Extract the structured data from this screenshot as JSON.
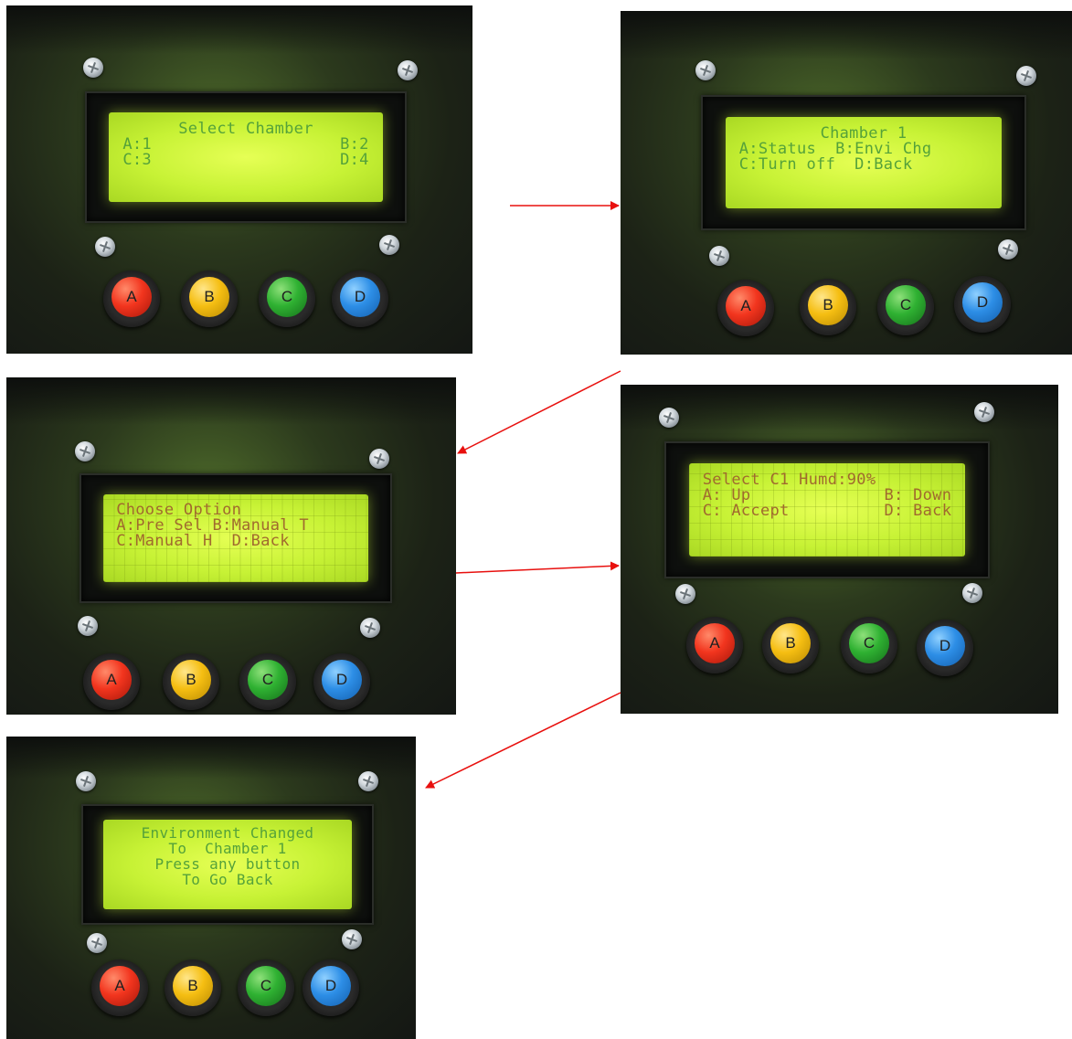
{
  "colors": {
    "arrow": "#e8100e",
    "lcd_text_green": "#55a23a",
    "lcd_text_red": "#a06a2e"
  },
  "button_labels": [
    "A",
    "B",
    "C",
    "D"
  ],
  "screens": [
    {
      "id": "select-chamber",
      "lines": [
        {
          "center": "Select Chamber"
        },
        {
          "left": "A:1",
          "right": "B:2"
        },
        {
          "left": "C:3",
          "right": "D:4"
        }
      ]
    },
    {
      "id": "chamber-1-menu",
      "lines": [
        {
          "center": "Chamber 1"
        },
        {
          "left": "A:Status  B:Envi Chg"
        },
        {
          "left": "C:Turn off  D:Back"
        }
      ]
    },
    {
      "id": "choose-option",
      "lines": [
        {
          "left": "Choose Option"
        },
        {
          "left": "A:Pre Sel B:Manual T"
        },
        {
          "left": "C:Manual H  D:Back"
        }
      ]
    },
    {
      "id": "select-humidity",
      "lines": [
        {
          "left": "Select C1 Humd:90%"
        },
        {
          "left": "A: Up",
          "right": "B: Down"
        },
        {
          "left": "C: Accept",
          "right": "D: Back"
        }
      ]
    },
    {
      "id": "environment-changed",
      "lines": [
        {
          "center": "Environment Changed"
        },
        {
          "center": "To  Chamber 1"
        },
        {
          "center": "Press any button"
        },
        {
          "center": "To Go Back"
        }
      ]
    }
  ]
}
